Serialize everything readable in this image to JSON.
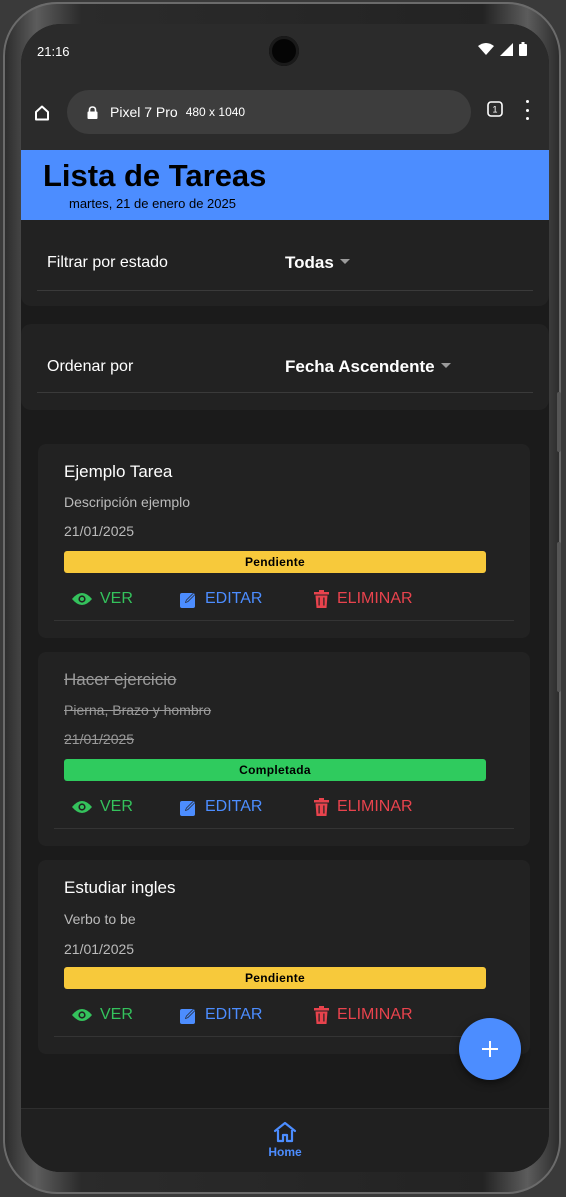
{
  "status_bar": {
    "time": "21:16"
  },
  "browser": {
    "device_name": "Pixel 7 Pro",
    "viewport": "480 x 1040",
    "tab_count": "1"
  },
  "header": {
    "title": "Lista de Tareas",
    "date": "martes, 21 de enero de 2025"
  },
  "filter": {
    "label": "Filtrar por estado",
    "selected": "Todas"
  },
  "sort": {
    "label": "Ordenar por",
    "selected": "Fecha Ascendente"
  },
  "actions": {
    "view": "VER",
    "edit": "EDITAR",
    "delete": "ELIMINAR"
  },
  "tasks": [
    {
      "title": "Ejemplo Tarea",
      "description": "Descripción ejemplo",
      "date": "21/01/2025",
      "status": "Pendiente",
      "completed": false
    },
    {
      "title": "Hacer ejercicio",
      "description": "Pierna, Brazo y hombro",
      "date": "21/01/2025",
      "status": "Completada",
      "completed": true
    },
    {
      "title": "Estudiar ingles",
      "description": "Verbo to be",
      "date": "21/01/2025",
      "status": "Pendiente",
      "completed": false
    }
  ],
  "fab": {
    "icon": "plus-icon"
  },
  "bottom_nav": {
    "home_label": "Home",
    "home_icon": "home-icon"
  },
  "colors": {
    "accent": "#4c8dff",
    "pending": "#f7c93b",
    "completed": "#2fcb5e",
    "view": "#34c25c",
    "delete": "#e8434d"
  }
}
